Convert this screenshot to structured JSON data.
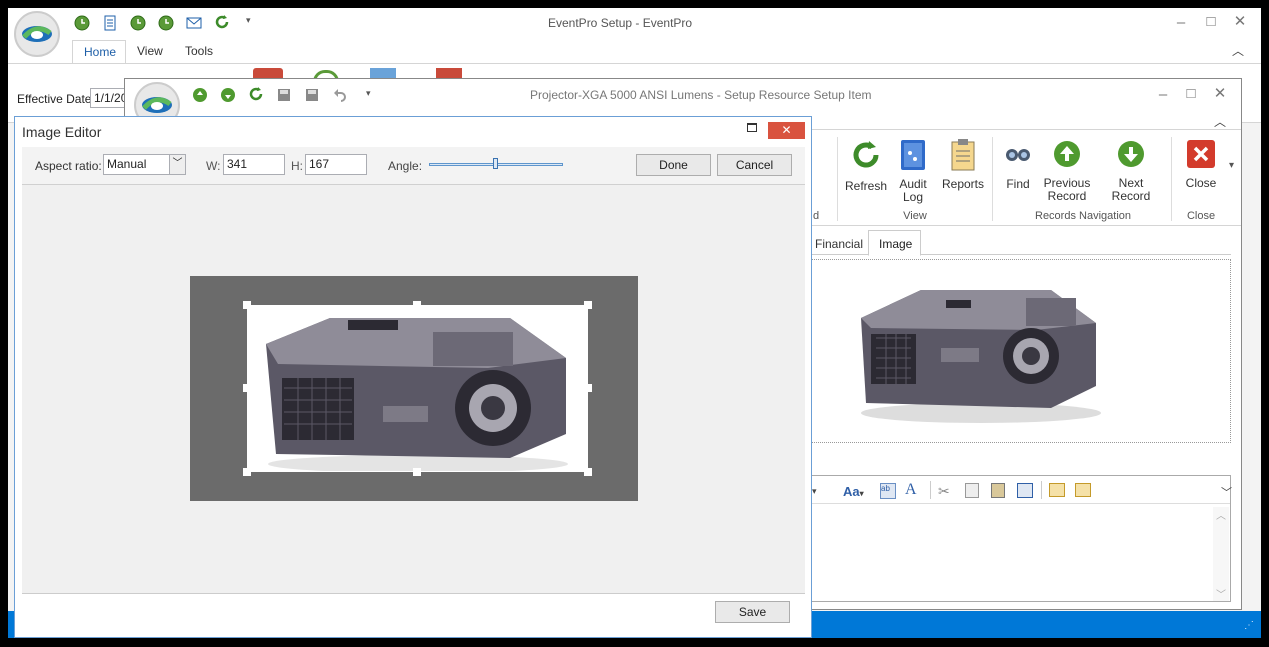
{
  "main": {
    "title": "EventPro Setup - EventPro",
    "tabs": [
      "Home",
      "View",
      "Tools"
    ],
    "effective_date_label": "Effective Date",
    "effective_date_value": "1/1/20"
  },
  "setup_item": {
    "title": "Projector-XGA 5000 ANSI Lumens - Setup Resource Setup Item",
    "ribbon": {
      "refresh": "Refresh",
      "audit_log": "Audit Log",
      "reports": "Reports",
      "find": "Find",
      "previous_record": "Previous Record",
      "next_record": "Next Record",
      "close": "Close",
      "group_partial": "d",
      "group_view": "View",
      "group_records": "Records Navigation",
      "group_close": "Close"
    },
    "tabs": {
      "financial": "Financial",
      "image": "Image"
    },
    "format_font": "Aa"
  },
  "image_editor": {
    "title": "Image Editor",
    "aspect_label": "Aspect ratio:",
    "aspect_value": "Manual",
    "w_label": "W:",
    "w_value": "341",
    "h_label": "H:",
    "h_value": "167",
    "angle_label": "Angle:",
    "done": "Done",
    "cancel": "Cancel",
    "save": "Save"
  },
  "colors": {
    "accent": "#0078d7",
    "close_red": "#c0392b",
    "status_bar": "#0078d7"
  }
}
